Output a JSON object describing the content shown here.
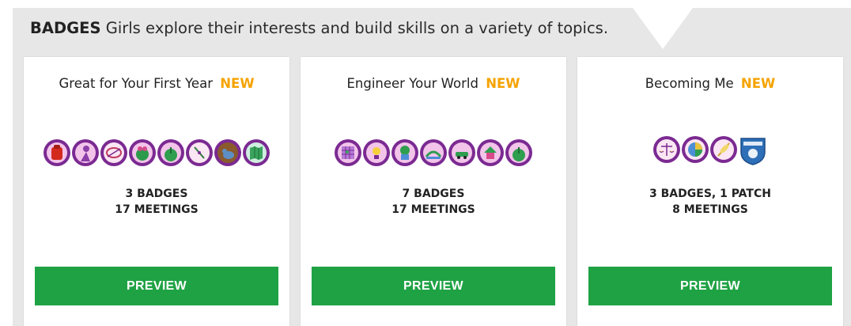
{
  "header": {
    "title": "BADGES",
    "subtitle": "Girls explore their interests and build skills on a variety of topics."
  },
  "colors": {
    "panel_bg": "#e7e7e7",
    "new_label": "#f5a300",
    "preview_button": "#1fa244",
    "badge_border": "#7b2a92",
    "badge_fill": "#f3c4ea"
  },
  "cards": [
    {
      "title": "Great for Your First Year",
      "new_label": "NEW",
      "badges": [
        "red-backpack-icon",
        "purple-figure-icon",
        "pink-loop-icon",
        "green-heart-icon",
        "green-sprout-icon",
        "clock-hands-icon",
        "bird-icon",
        "map-icon"
      ],
      "stats_line1": "3 BADGES",
      "stats_line2": "17 MEETINGS",
      "button_label": "PREVIEW"
    },
    {
      "title": "Engineer Your World",
      "new_label": "NEW",
      "badges": [
        "grid-board-icon",
        "lightbulb-icon",
        "cup-tree-icon",
        "bridge-icon",
        "car-icon",
        "house-icon",
        "green-sprout-icon"
      ],
      "stats_line1": "7 BADGES",
      "stats_line2": "17 MEETINGS",
      "button_label": "PREVIEW"
    },
    {
      "title": "Becoming Me",
      "new_label": "NEW",
      "badges": [
        "scales-icon",
        "pie-chart-icon",
        "feather-icon"
      ],
      "patch": "becoming-me-patch-icon",
      "stats_line1": "3 BADGES, 1 PATCH",
      "stats_line2": "8 MEETINGS",
      "button_label": "PREVIEW"
    }
  ]
}
